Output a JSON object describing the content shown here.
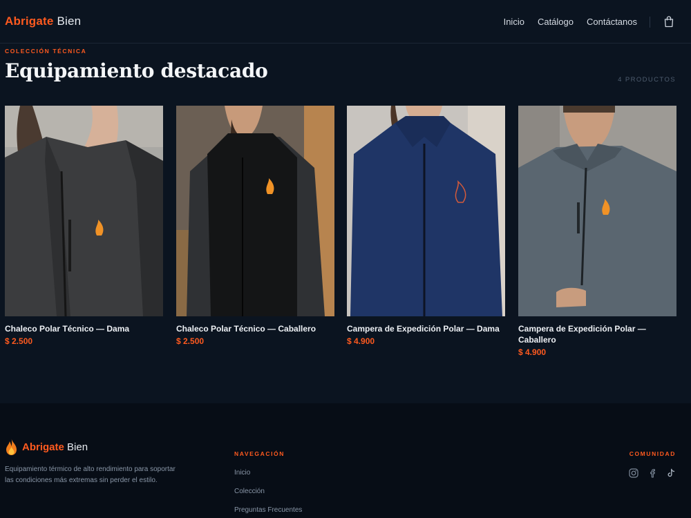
{
  "header": {
    "brand": "Abrigate",
    "brand_rest": "Bien",
    "nav": [
      "Inicio",
      "Catálogo",
      "Contáctanos"
    ],
    "cart_icon": "shopping-bag-icon"
  },
  "section": {
    "eyebrow": "COLECCIÓN TÉCNICA",
    "title": "Equipamiento destacado",
    "count": "4 PRODUCTOS"
  },
  "products": [
    {
      "name": "Chaleco Polar Técnico — Dama",
      "price": "$ 2.500",
      "color": "#3a3b3d"
    },
    {
      "name": "Chaleco Polar Técnico — Caballero",
      "price": "$ 2.500",
      "color": "#141516"
    },
    {
      "name": "Campera de Expedición Polar — Dama",
      "price": "$ 4.900",
      "color": "#1f3566"
    },
    {
      "name": "Campera de Expedición Polar — Caballero",
      "price": "$ 4.900",
      "color": "#5a6670"
    }
  ],
  "footer": {
    "brand": "Abrigate",
    "brand_rest": "Bien",
    "logo_icon": "flame-icon",
    "description": "Equipamiento térmico de alto rendimiento para soportar las condiciones más extremas sin perder el estilo.",
    "nav_title": "NAVEGACIÓN",
    "nav_items": [
      "Inicio",
      "Colección",
      "Preguntas Frecuentes"
    ],
    "community_title": "COMUNIDAD",
    "social_icons": [
      "instagram-icon",
      "facebook-icon",
      "tiktok-icon"
    ]
  },
  "colors": {
    "accent": "#ff5a1f",
    "background": "#0b1420",
    "footer_background": "#070d16"
  }
}
